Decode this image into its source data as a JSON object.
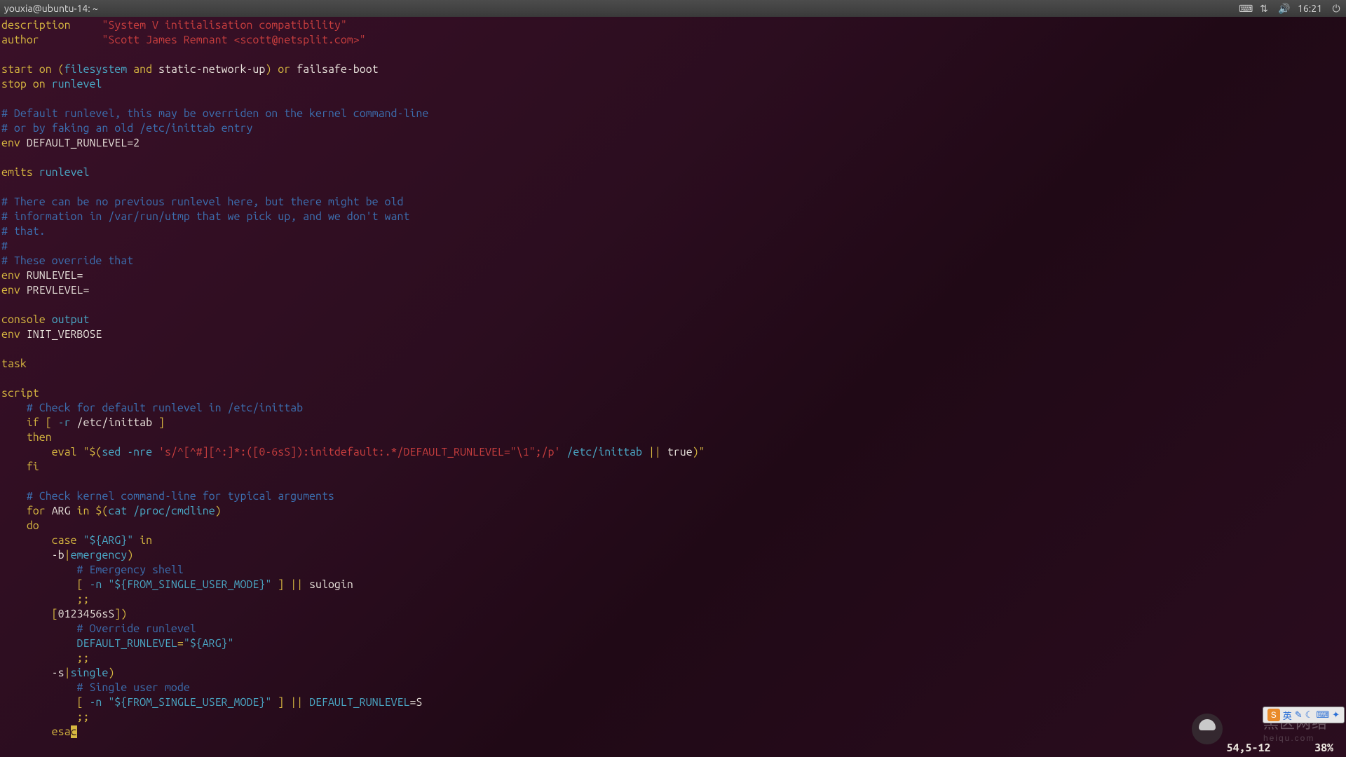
{
  "panel": {
    "title": "youxia@ubuntu-14: ~",
    "icons": {
      "keyboard": "⌨",
      "network": "⇅",
      "sound": "🔊",
      "power": "⏻"
    },
    "clock": "16:21"
  },
  "ime": {
    "logo": "S",
    "lang": "英",
    "icons": [
      "✎",
      "☾",
      "⌨",
      "✦"
    ]
  },
  "watermark": {
    "text": "黑区网络",
    "sub": "heiqu.com"
  },
  "status": {
    "pos": "54,5-12",
    "pct": "38%"
  },
  "code": {
    "l01a": "description",
    "l01b": "     \"System V initialisation compatibility\"",
    "l02a": "author",
    "l02b": "          \"Scott James Remnant <scott@netsplit.com>\"",
    "l04a": "start on ",
    "l04b": "(",
    "l04c": "filesystem",
    "l04d": " and ",
    "l04e": "static-network-up",
    "l04f": ")",
    "l04g": " or ",
    "l04h": "failsafe-boot",
    "l05a": "stop on ",
    "l05b": "runlevel",
    "l07": "# Default runlevel, this may be overriden on the kernel command-line",
    "l08": "# or by faking an old /etc/inittab entry",
    "l09a": "env",
    "l09b": " DEFAULT_RUNLEVEL=2",
    "l11a": "emits ",
    "l11b": "runlevel",
    "l13": "# There can be no previous runlevel here, but there might be old",
    "l14": "# information in /var/run/utmp that we pick up, and we don't want",
    "l15": "# that.",
    "l16": "#",
    "l17": "# These override that",
    "l18a": "env",
    "l18b": " RUNLEVEL=",
    "l19a": "env",
    "l19b": " PREVLEVEL=",
    "l21a": "console ",
    "l21b": "output",
    "l22a": "env",
    "l22b": " INIT_VERBOSE",
    "l24": "task",
    "l26": "script",
    "l27": "    # Check for default runlevel in /etc/inittab",
    "l28a": "    if ",
    "l28b": "[",
    "l28c": " -r ",
    "l28d": "/etc/inittab ",
    "l28e": "]",
    "l29": "    then",
    "l30a": "        eval ",
    "l30b": "\"$(",
    "l30c": "sed",
    "l30d": " -nre ",
    "l30e": "'s/^[^#][^:]*:([0-6sS]):initdefault:.*/DEFAULT_RUNLEVEL=\"\\1\";/p'",
    "l30f": " /etc/inittab ",
    "l30g": "||",
    "l30h": " true",
    "l30i": ")\"",
    "l31": "    fi",
    "l33": "    # Check kernel command-line for typical arguments",
    "l34a": "    for ",
    "l34b": "ARG",
    "l34c": " in ",
    "l34d": "$(",
    "l34e": "cat /proc/cmdline",
    "l34f": ")",
    "l35": "    do",
    "l36a": "        case ",
    "l36b": "\"${ARG}\"",
    "l36c": " in",
    "l37a": "        -b",
    "l37b": "|",
    "l37c": "emergency",
    "l37d": ")",
    "l38": "            # Emergency shell",
    "l39a": "            [",
    "l39b": " -n ",
    "l39c": "\"${FROM_SINGLE_USER_MODE}\"",
    "l39d": " ] ",
    "l39e": "||",
    "l39f": " sulogin",
    "l40": "            ;;",
    "l41a": "        [",
    "l41b": "0123456sS",
    "l41c": "]",
    ")": ")",
    "l42": "            # Override runlevel",
    "l43a": "            DEFAULT_RUNLEVEL",
    "l43b": "=",
    "l43c": "\"${ARG}\"",
    "l44": "            ;;",
    "l45a": "        -s",
    "l45b": "|",
    "l45c": "single",
    "l45d": ")",
    "l46": "            # Single user mode",
    "l47a": "            [",
    "l47b": " -n ",
    "l47c": "\"${FROM_SINGLE_USER_MODE}\"",
    "l47d": " ] ",
    "l47e": "||",
    "l47f": " DEFAULT_RUNLEVEL",
    "l47g": "=S",
    "l48": "            ;;",
    "l49a": "        esa",
    "l49b": "c"
  }
}
